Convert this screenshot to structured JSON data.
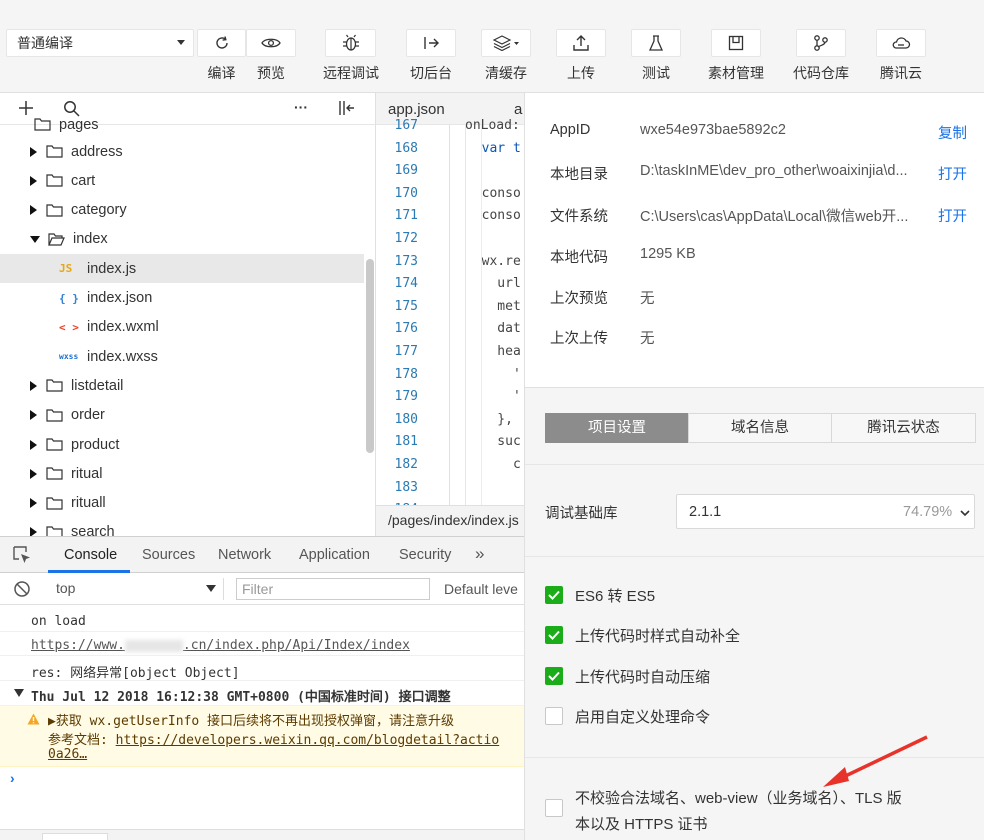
{
  "toolbar": {
    "mode_select": "普通编译",
    "buttons": [
      {
        "label": "编译",
        "icon": "refresh-icon"
      },
      {
        "label": "预览",
        "icon": "eye-icon"
      },
      {
        "label": "远程调试",
        "icon": "bug-icon"
      },
      {
        "label": "切后台",
        "icon": "switch-background-icon"
      },
      {
        "label": "清缓存",
        "icon": "layers-icon"
      },
      {
        "label": "上传",
        "icon": "upload-icon"
      },
      {
        "label": "测试",
        "icon": "flask-icon"
      },
      {
        "label": "素材管理",
        "icon": "material-icon"
      },
      {
        "label": "代码仓库",
        "icon": "git-icon"
      },
      {
        "label": "腾讯云",
        "icon": "cloud-icon"
      }
    ]
  },
  "file_tree": {
    "top_partial": "pages",
    "items": [
      {
        "name": "address",
        "type": "folder",
        "expanded": false
      },
      {
        "name": "cart",
        "type": "folder",
        "expanded": false
      },
      {
        "name": "category",
        "type": "folder",
        "expanded": false
      },
      {
        "name": "index",
        "type": "folder",
        "expanded": true
      },
      {
        "name": "index.js",
        "type": "js",
        "icon_text": "JS",
        "selected": true
      },
      {
        "name": "index.json",
        "type": "json",
        "icon_text": "{ }"
      },
      {
        "name": "index.wxml",
        "type": "wxml",
        "icon_text": "< >"
      },
      {
        "name": "index.wxss",
        "type": "wxss",
        "icon_text": "wxss"
      },
      {
        "name": "listdetail",
        "type": "folder",
        "expanded": false
      },
      {
        "name": "order",
        "type": "folder",
        "expanded": false
      },
      {
        "name": "product",
        "type": "folder",
        "expanded": false
      },
      {
        "name": "ritual",
        "type": "folder",
        "expanded": false
      },
      {
        "name": "rituall",
        "type": "folder",
        "expanded": false
      },
      {
        "name": "search",
        "type": "folder",
        "expanded": false
      }
    ]
  },
  "editor": {
    "tabs": [
      "app.json",
      "a"
    ],
    "line_numbers": [
      "167",
      "168",
      "169",
      "170",
      "171",
      "172",
      "173",
      "174",
      "175",
      "176",
      "177",
      "178",
      "179",
      "180",
      "181",
      "182",
      "183",
      "184"
    ],
    "code_lines": [
      "onLoad:",
      "  var t",
      "",
      "  conso",
      "  conso",
      "",
      "  wx.re",
      "    url",
      "    met",
      "    dat",
      "    hea",
      "      '",
      "      '",
      "    },",
      "    suc",
      "      c",
      "",
      ""
    ],
    "status_path": "/pages/index/index.js"
  },
  "devtools": {
    "tabs": [
      "Console",
      "Sources",
      "Network",
      "Application",
      "Security"
    ],
    "active_tab": "Console",
    "context": "top",
    "filter_placeholder": "Filter",
    "levels": "Default leve",
    "lines": [
      "on load",
      "https://www.",
      ".cn/index.php/Api/Index/index",
      "res: 网络异常[object Object]",
      "Thu Jul 12 2018 16:12:38 GMT+0800 (中国标准时间) 接口调整"
    ],
    "warning": {
      "line1": "▶获取 wx.getUserInfo 接口后续将不再出现授权弹窗，请注意升级",
      "line2_prefix": "参考文档: ",
      "line2_link": "https://developers.weixin.qq.com/blogdetail?actio",
      "line3": "0a26…"
    }
  },
  "details": {
    "info": [
      {
        "key": "AppID",
        "value": "wxe54e973bae5892c2",
        "action": "复制"
      },
      {
        "key": "本地目录",
        "value": "D:\\taskInME\\dev_pro_other\\woaixinjia\\d...",
        "action": "打开"
      },
      {
        "key": "文件系统",
        "value": "C:\\Users\\cas\\AppData\\Local\\微信web开...",
        "action": "打开"
      },
      {
        "key": "本地代码",
        "value": "1295 KB",
        "action": ""
      },
      {
        "key": "上次预览",
        "value": "无",
        "action": ""
      },
      {
        "key": "上次上传",
        "value": "无",
        "action": ""
      }
    ],
    "segments": [
      "项目设置",
      "域名信息",
      "腾讯云状态"
    ],
    "active_segment": "项目设置",
    "lib_label": "调试基础库",
    "lib_version": "2.1.1",
    "lib_percent": "74.79%",
    "options": [
      {
        "label": "ES6 转 ES5",
        "checked": true
      },
      {
        "label": "上传代码时样式自动补全",
        "checked": true
      },
      {
        "label": "上传代码时自动压缩",
        "checked": true
      },
      {
        "label": "启用自定义处理命令",
        "checked": false
      }
    ],
    "domain_option": {
      "line1": "不校验合法域名、web-view（业务域名）、TLS 版",
      "line2": "本以及 HTTPS 证书",
      "checked": false
    },
    "colors": {
      "accent": "#1a73e8",
      "check": "#1aad19",
      "arrow": "#e8332a"
    }
  }
}
